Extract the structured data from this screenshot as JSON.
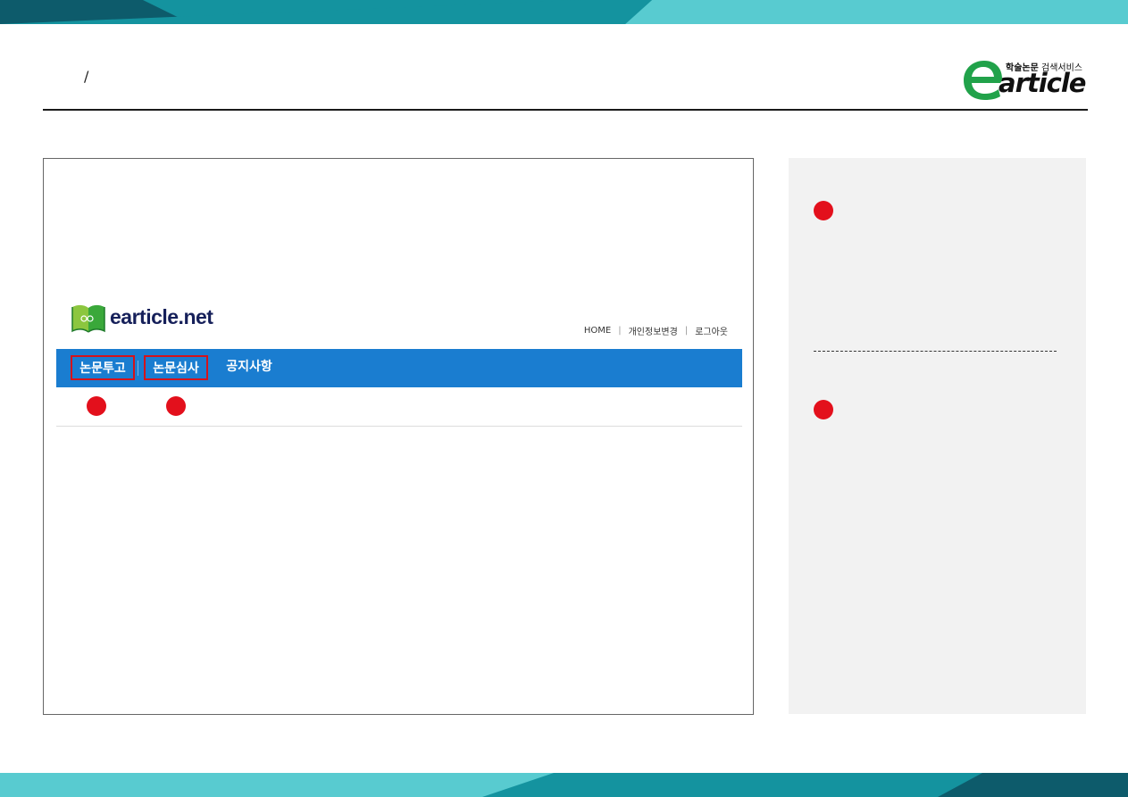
{
  "slide": {
    "title": "/"
  },
  "brand": {
    "wordmark_letter": "e",
    "wordmark_rest": "article",
    "subtitle_bold": "학술논문",
    "subtitle_regular": " 검색서비스",
    "color_green": "#21a24a",
    "color_text": "#101010"
  },
  "site": {
    "name": "earticle.net",
    "util_nav": [
      "HOME",
      "개인정보변경",
      "로그아웃"
    ],
    "gnb": [
      {
        "label": "논문투고",
        "highlighted": true
      },
      {
        "label": "논문심사",
        "highlighted": true
      },
      {
        "label": "공지사항",
        "highlighted": false
      }
    ],
    "gnb_color": "#1a7dd0",
    "highlight_color": "#d4131b"
  },
  "colors": {
    "marker": "#e3101c",
    "band_dark": "#0d5b6b",
    "band_mid": "#14939f",
    "band_light": "#58cbd0",
    "side_panel": "#f2f2f2"
  }
}
